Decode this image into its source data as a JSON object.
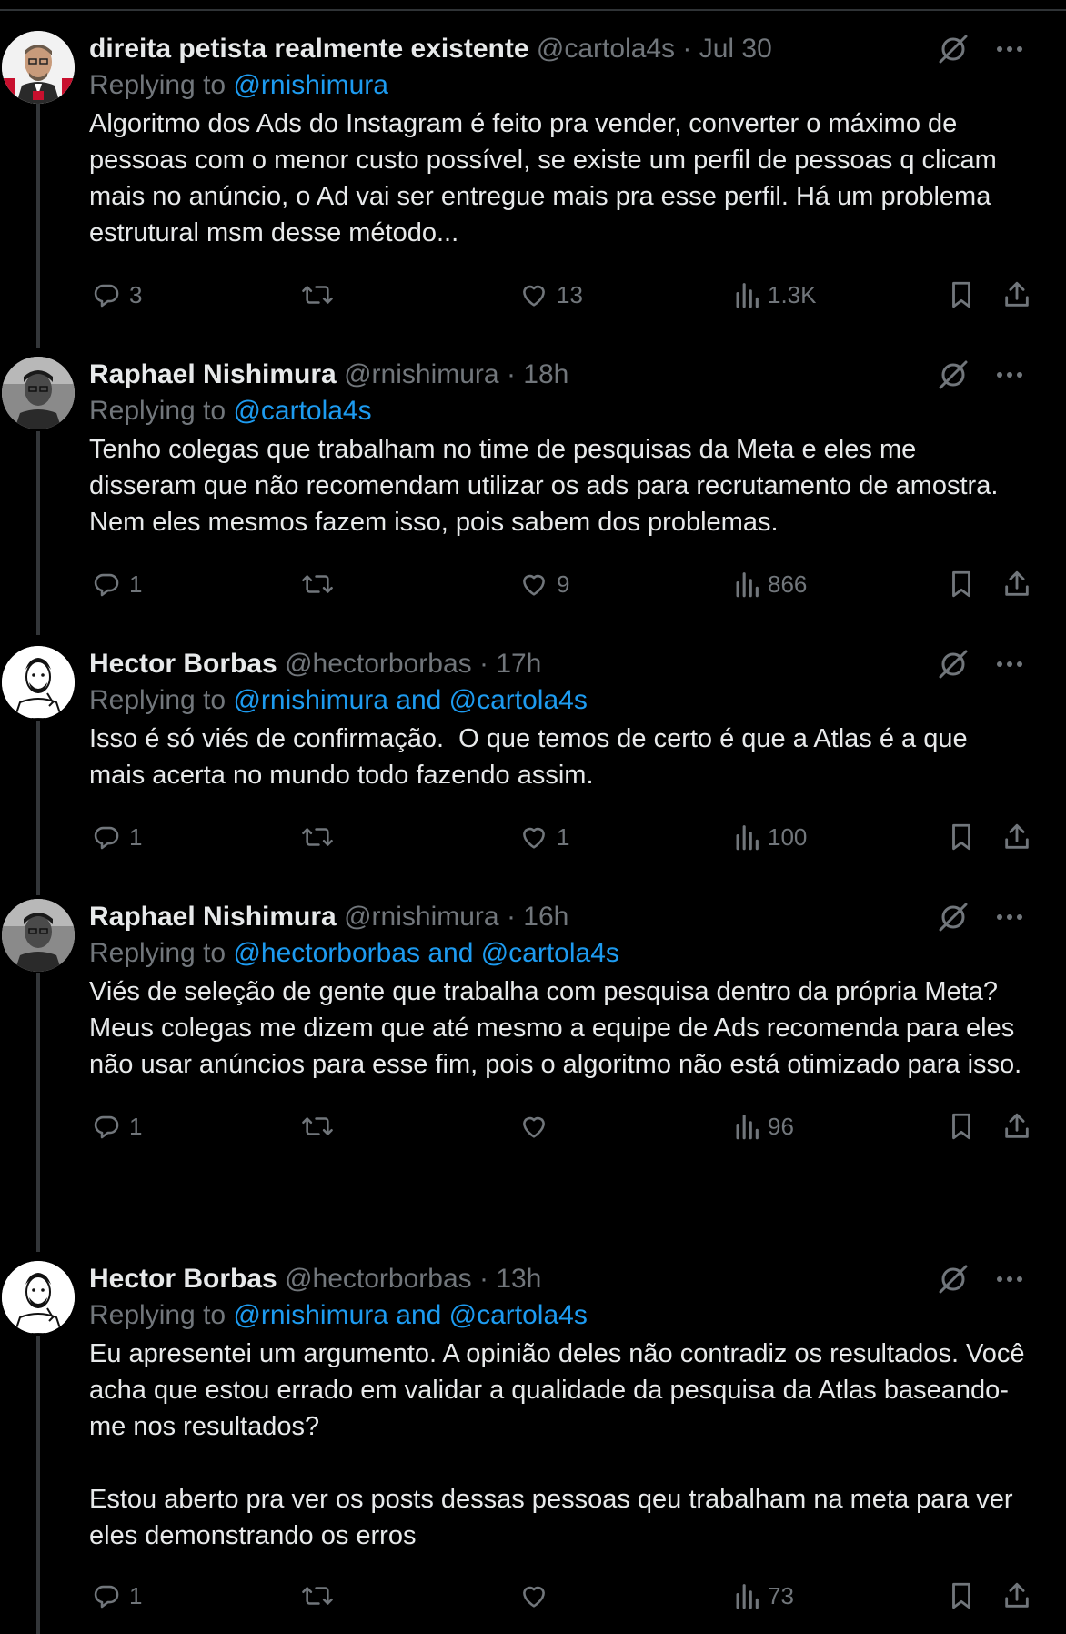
{
  "reply_prefix": "Replying to",
  "tweets": [
    {
      "name": "direita petista realmente existente",
      "handle": "@cartola4s",
      "time": "Jul 30",
      "replying_to": "@rnishimura",
      "text": "Algoritmo dos Ads do Instagram é feito pra vender, converter o máximo de pessoas com o menor custo possível, se existe um perfil de pessoas q clicam mais no anúncio, o Ad vai ser entregue mais pra esse perfil. Há um problema estrutural msm desse método...",
      "replies": "3",
      "retweets": "",
      "likes": "13",
      "views": "1.3K"
    },
    {
      "name": "Raphael Nishimura",
      "handle": "@rnishimura",
      "time": "18h",
      "replying_to": "@cartola4s",
      "text": "Tenho colegas que trabalham no time de pesquisas da Meta e eles me disseram que não recomendam utilizar os ads para recrutamento de amostra. Nem eles mesmos fazem isso, pois sabem dos problemas.",
      "replies": "1",
      "retweets": "",
      "likes": "9",
      "views": "866"
    },
    {
      "name": "Hector Borbas",
      "handle": "@hectorborbas",
      "time": "17h",
      "replying_to": "@rnishimura and @cartola4s",
      "text": "Isso é só viés de confirmação.  O que temos de certo é que a Atlas é a que mais acerta no mundo todo fazendo assim.",
      "replies": "1",
      "retweets": "",
      "likes": "1",
      "views": "100"
    },
    {
      "name": "Raphael Nishimura",
      "handle": "@rnishimura",
      "time": "16h",
      "replying_to": "@hectorborbas and @cartola4s",
      "text": "Viés de seleção de gente que trabalha com pesquisa dentro da própria Meta?\nMeus colegas me dizem que até mesmo a equipe de Ads recomenda para eles não usar anúncios para esse fim, pois o algoritmo não está otimizado para isso.",
      "replies": "1",
      "retweets": "",
      "likes": "",
      "views": "96"
    },
    {
      "name": "Hector Borbas",
      "handle": "@hectorborbas",
      "time": "13h",
      "replying_to": "@rnishimura and @cartola4s",
      "text": "Eu apresentei um argumento. A opinião deles não contradiz os resultados. Você acha que estou errado em validar a qualidade da pesquisa da Atlas baseando-me nos resultados?\n\nEstou aberto pra ver os posts dessas pessoas qeu trabalham na meta para ver eles demonstrando os erros",
      "replies": "1",
      "retweets": "",
      "likes": "",
      "views": "73"
    }
  ],
  "colors": {
    "background": "#000000",
    "text": "#e7e9ea",
    "secondary": "#71767b",
    "accent": "#1d9bf0",
    "thread_line": "#333639"
  },
  "icons": {
    "header": [
      "grok-icon",
      "more-icon"
    ],
    "actions": [
      "reply-icon",
      "retweet-icon",
      "like-icon",
      "views-icon",
      "bookmark-icon",
      "share-icon"
    ]
  }
}
